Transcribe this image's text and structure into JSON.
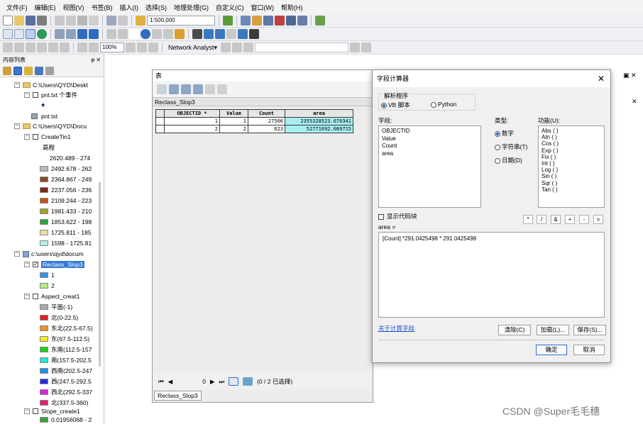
{
  "menu": [
    "文件(F)",
    "编辑(E)",
    "视图(V)",
    "书签(B)",
    "插入(I)",
    "选择(S)",
    "地理处理(G)",
    "自定义(C)",
    "窗口(W)",
    "帮助(H)"
  ],
  "toolbar": {
    "scale": "1:500,000",
    "zoom_pct": "100%",
    "network_analyst": "Network Analyst▾"
  },
  "toc": {
    "title": "内容列表",
    "pin": "ᵽ ✕",
    "items": [
      {
        "label": "C:\\Users\\QYD\\Deskt"
      },
      {
        "label": "pnt.txt 个事件"
      },
      {
        "label": "◆"
      },
      {
        "label": "pnt.txt"
      },
      {
        "label": "C:\\Users\\QYD\\Docu"
      },
      {
        "label": "CreateTin1"
      },
      {
        "label": "高程"
      },
      {
        "label": "2620.489 - 274"
      },
      {
        "label": "2492.678 - 262"
      },
      {
        "label": "2364.867 - 249"
      },
      {
        "label": "2237.056 - 236"
      },
      {
        "label": "2109.244 - 223"
      },
      {
        "label": "1981.433 - 210"
      },
      {
        "label": "1853.622 - 198"
      },
      {
        "label": "1725.811 - 185"
      },
      {
        "label": "1598 - 1725.81"
      },
      {
        "label": "c:\\users\\qyd\\docum"
      },
      {
        "label": "Reclass_Slop3"
      },
      {
        "label": "1"
      },
      {
        "label": "2"
      },
      {
        "label": "Aspect_creat1"
      },
      {
        "label": "平面(-1)"
      },
      {
        "label": "北(0-22.5)"
      },
      {
        "label": "东北(22.5-67.5)"
      },
      {
        "label": "东(67.5-112.5)"
      },
      {
        "label": "东南(112.5-157"
      },
      {
        "label": "南(157.5-202.5"
      },
      {
        "label": "西南(202.5-247"
      },
      {
        "label": "西(247.5-292.5"
      },
      {
        "label": "西北(292.5-337"
      },
      {
        "label": "北(337.5-360)"
      },
      {
        "label": "Slope_create1"
      },
      {
        "label": "0.01956068 - 2"
      }
    ],
    "colors": {
      "elev": [
        "#b8b8b8",
        "#8a4a2a",
        "#7a2a1a",
        "#c0521a",
        "#a4a028",
        "#2aa03a",
        "#e6e0a0",
        "#aef0ea"
      ],
      "reclass": [
        "#3c8ee0",
        "#b8e88a"
      ],
      "aspect": [
        "#a8a8a8",
        "#e02020",
        "#f09020",
        "#f8e820",
        "#20d020",
        "#20e8d8",
        "#2090e0",
        "#2828e0",
        "#e020e0",
        "#e01e6e"
      ],
      "slope": "#3aa03a"
    }
  },
  "table": {
    "title": "表",
    "name": "Reclass_Slop3",
    "columns": [
      "OBJECTID *",
      "Value",
      "Count",
      "area"
    ],
    "rows": [
      [
        "1",
        "1",
        "27506",
        "2355328523.670341"
      ],
      [
        "2",
        "2",
        "623",
        "52771692.089715"
      ]
    ],
    "record": "0",
    "status": "(0 / 2 已选择)",
    "tab": "Reclass_Slop3"
  },
  "dialog": {
    "title": "字段计算器",
    "parser_label": "解析程序",
    "parser_vb": "VB 脚本",
    "parser_python": "Python",
    "fields_label": "字段:",
    "fields": [
      "OBJECTID",
      "Value",
      "Count",
      "area"
    ],
    "type_label": "类型:",
    "type_number": "数字",
    "type_string": "字符串(T)",
    "type_date": "日期(D)",
    "functions_label": "功能(U):",
    "functions": [
      "Abs ( )",
      "Atn ( )",
      "Cos ( )",
      "Exp ( )",
      "Fix ( )",
      "Int ( )",
      "Log ( )",
      "Sin ( )",
      "Sqr ( )",
      "Tan ( )"
    ],
    "show_code": "显示代码块",
    "operators": [
      "*",
      "/",
      "&",
      "+",
      "-",
      "="
    ],
    "target": "area =",
    "expression": "[Count] *291.0425498 * 291.0425498",
    "about_link": "关于计算字段",
    "clear": "清除(C)",
    "load": "加载(L)...",
    "save": "保存(S)...",
    "ok": "确定",
    "cancel": "取消"
  },
  "watermark": "CSDN @Super毛毛穗"
}
